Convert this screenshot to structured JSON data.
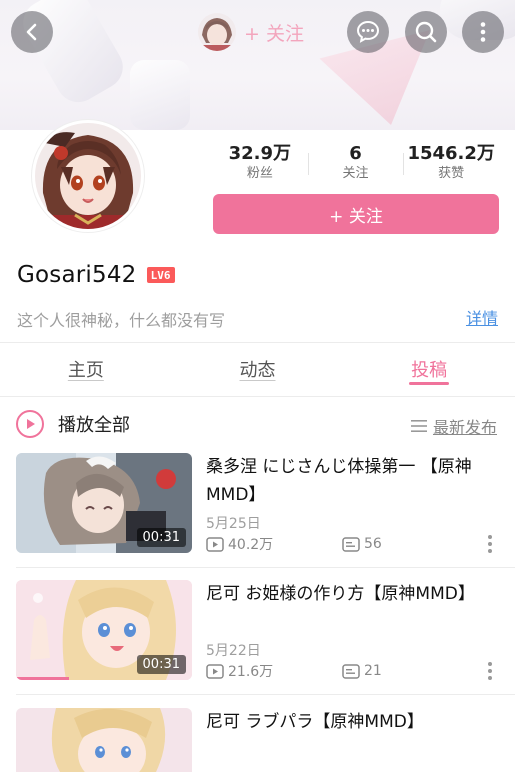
{
  "header": {
    "top_follow_label": "+ 关注"
  },
  "profile": {
    "username": "Gosari542",
    "level": "LV6",
    "sign": "这个人很神秘，什么都没有写",
    "details_label": "详情",
    "follow_label": "+ 关注",
    "stats": [
      {
        "value": "32.9万",
        "label": "粉丝"
      },
      {
        "value": "6",
        "label": "关注"
      },
      {
        "value": "1546.2万",
        "label": "获赞"
      }
    ]
  },
  "tabs": [
    {
      "label": "主页"
    },
    {
      "label": "动态"
    },
    {
      "label": "投稿",
      "active": true
    }
  ],
  "list_header": {
    "play_all": "播放全部",
    "sort_label": "最新发布"
  },
  "videos": [
    {
      "title": "桑多涅 にじさんじ体操第一 【原神MMD】",
      "date": "5月25日",
      "views": "40.2万",
      "danmaku": "56",
      "duration": "00:31"
    },
    {
      "title": "尼可 お姫様の作り方【原神MMD】",
      "date": "5月22日",
      "views": "21.6万",
      "danmaku": "21",
      "duration": "00:31",
      "progress": 0.3
    },
    {
      "title": "尼可 ラブパラ【原神MMD】"
    }
  ],
  "colors": {
    "accent": "#f0739b",
    "link": "#4a90e2"
  }
}
